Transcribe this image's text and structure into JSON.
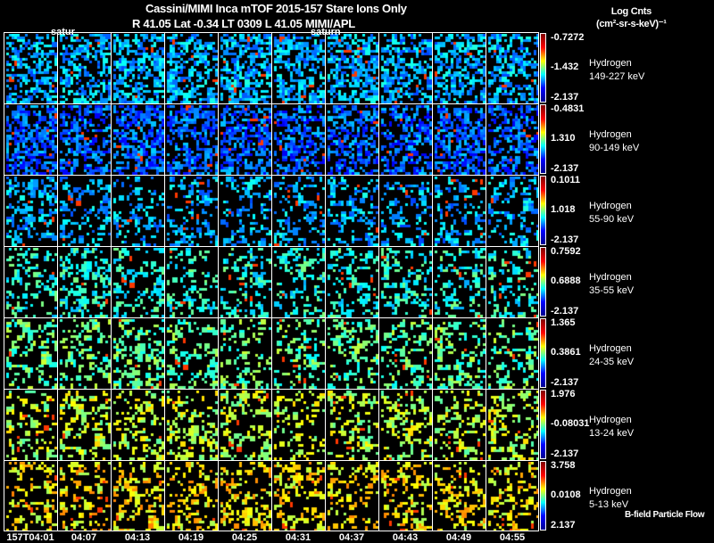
{
  "header": {
    "title_line1": "Cassini/MIMI Inca mTOF  2015-157    Stare    Ions Only",
    "title_line2": "R          41.05 Lat -0.34 LT 0309 L          41.05  MIMI/APL",
    "units_line1": "Log Cnts",
    "units_line2": "(cm²-sr-s-keV)⁻¹"
  },
  "overlay_labels": [
    "satur",
    "saturn"
  ],
  "footer_note": "B-field Particle Flow",
  "chart_data": {
    "type": "heatmap",
    "colormap": "jet",
    "columns": [
      "157T04:01",
      "04:07",
      "04:13",
      "04:19",
      "04:25",
      "04:31",
      "04:37",
      "04:43",
      "04:49",
      "04:55"
    ],
    "rows": [
      {
        "species": "Hydrogen",
        "energy": "149-227 keV",
        "cbar_top": "-0.7272",
        "cbar_mid": "-1.432",
        "cbar_bottom": "-2.137",
        "typical_level": 0.3
      },
      {
        "species": "Hydrogen",
        "energy": "90-149 keV",
        "cbar_top": "-0.4831",
        "cbar_mid": "1.310",
        "cbar_bottom": "-2.137",
        "typical_level": 0.22
      },
      {
        "species": "Hydrogen",
        "energy": "55-90 keV",
        "cbar_top": "0.1011",
        "cbar_mid": "1.018",
        "cbar_bottom": "-2.137",
        "typical_level": 0.3
      },
      {
        "species": "Hydrogen",
        "energy": "35-55 keV",
        "cbar_top": "0.7592",
        "cbar_mid": "0.6888",
        "cbar_bottom": "-2.137",
        "typical_level": 0.4
      },
      {
        "species": "Hydrogen",
        "energy": "24-35 keV",
        "cbar_top": "1.365",
        "cbar_mid": "0.3861",
        "cbar_bottom": "-2.137",
        "typical_level": 0.47
      },
      {
        "species": "Hydrogen",
        "energy": "13-24 keV",
        "cbar_top": "1.976",
        "cbar_mid": "-0.08031",
        "cbar_bottom": "-2.137",
        "typical_level": 0.56
      },
      {
        "species": "Hydrogen",
        "energy": "5-13 keV",
        "cbar_top": "3.758",
        "cbar_mid": "0.0108",
        "cbar_bottom": "2.137",
        "typical_level": 0.64
      }
    ]
  }
}
